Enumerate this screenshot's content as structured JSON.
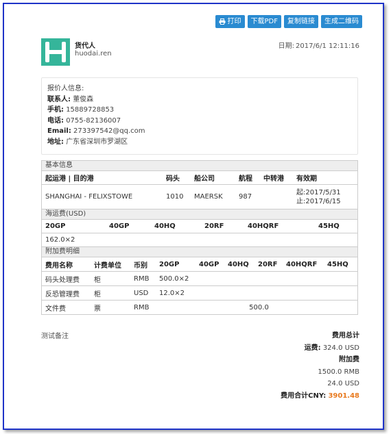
{
  "toolbar": {
    "print_label": "打印",
    "download_pdf_label": "下载PDF",
    "copy_link_label": "复制链接",
    "qr_label": "生成二维码"
  },
  "company": {
    "name": "货代人",
    "website": "huodai.ren",
    "logo_color": "#35b59a"
  },
  "date": {
    "label": "日期:",
    "value": "2017/6/1 12:11:16"
  },
  "quoter": {
    "heading": "报价人信息:",
    "contact_label": "联系人:",
    "contact_value": "董俊森",
    "mobile_label": "手机:",
    "mobile_value": "15889728853",
    "phone_label": "电话:",
    "phone_value": "0755-82136007",
    "email_label": "Email:",
    "email_value": "273397542@qq.com",
    "address_label": "地址:",
    "address_value": "广东省深圳市罗湖区"
  },
  "basic_info": {
    "title": "基本信息",
    "headers": [
      "起运港 | 目的港",
      "码头",
      "船公司",
      "航程",
      "中转港",
      "有效期"
    ],
    "row": {
      "route": "SHANGHAI - FELIXSTOWE",
      "terminal": "1010",
      "carrier": "MAERSK",
      "transit": "987",
      "transship": "",
      "valid_from": "起:2017/5/31",
      "valid_to": "止:2017/6/15"
    }
  },
  "ocean_freight": {
    "title": "海运费(USD)",
    "headers": [
      "20GP",
      "40GP",
      "40HQ",
      "20RF",
      "40HQRF",
      "45HQ"
    ],
    "values": [
      "162.0×2",
      "",
      "",
      "",
      "",
      ""
    ]
  },
  "surcharges": {
    "title": "附加费明细",
    "headers": [
      "费用名称",
      "计费单位",
      "币别",
      "20GP",
      "40GP",
      "40HQ",
      "20RF",
      "40HQRF",
      "45HQ"
    ],
    "rows": [
      {
        "name": "码头处理费",
        "unit": "柜",
        "currency": "RMB",
        "c20gp": "500.0×2"
      },
      {
        "name": "反恐管理费",
        "unit": "柜",
        "currency": "USD",
        "c20gp": "12.0×2"
      },
      {
        "name": "文件费",
        "unit": "票",
        "currency": "RMB",
        "total": "500.0"
      }
    ]
  },
  "remark": "测试备注",
  "summary": {
    "title": "费用总计",
    "freight_label": "运费:",
    "freight_value": "324.0 USD",
    "surcharge_title": "附加费",
    "surcharge_rmb": "1500.0 RMB",
    "surcharge_usd": "24.0 USD",
    "total_label": "费用合计CNY:",
    "total_value": "3901.48"
  }
}
